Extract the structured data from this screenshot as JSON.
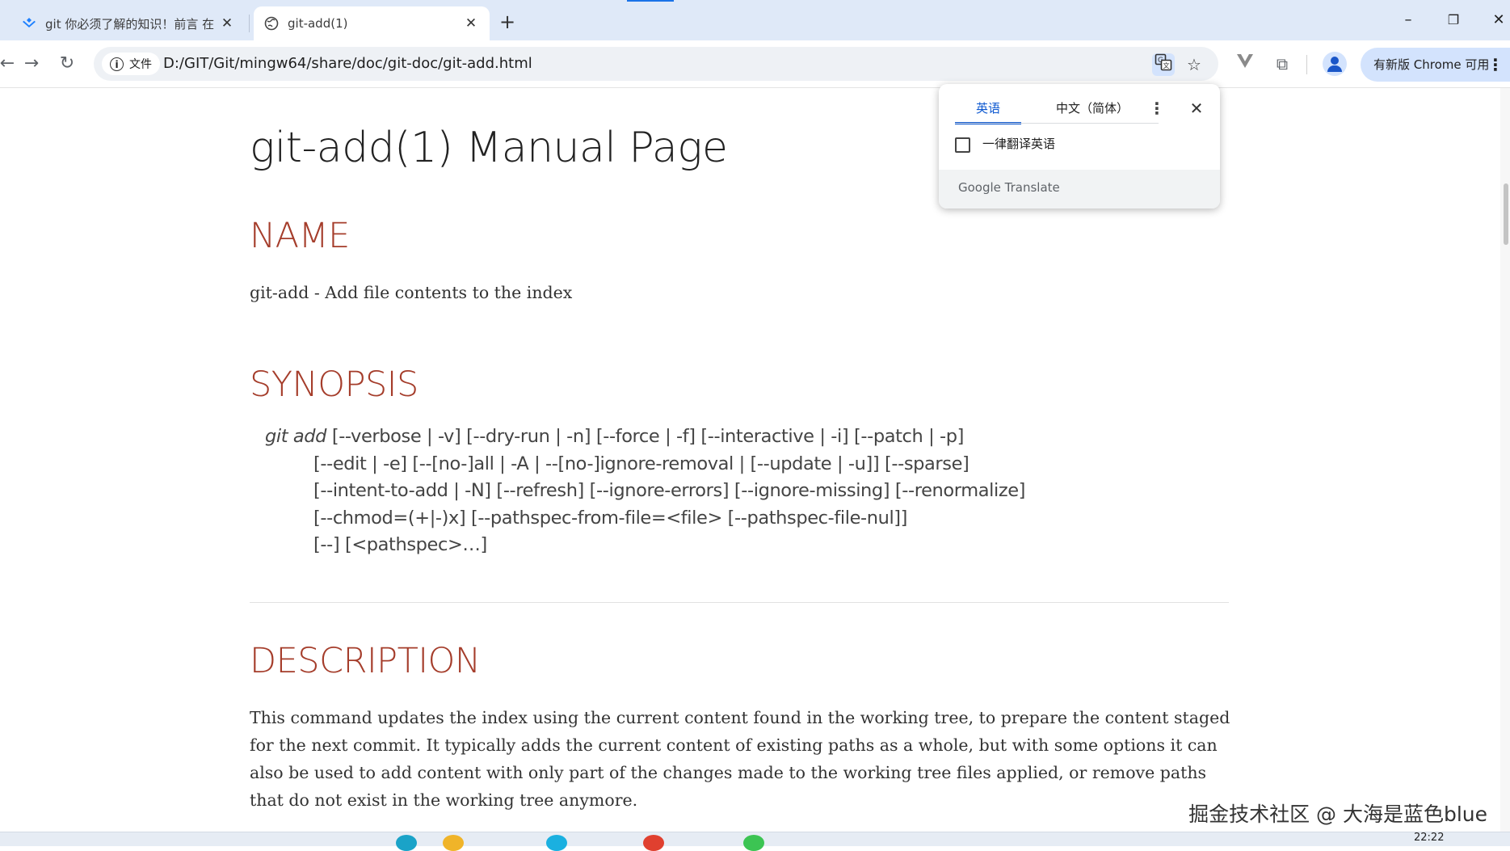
{
  "browser": {
    "tabs": [
      {
        "title": "git 你必须了解的知识！前言 在",
        "favicon": "juejin-icon",
        "active": false
      },
      {
        "title": "git-add(1)",
        "favicon": "globe-icon",
        "active": true
      }
    ],
    "new_tab_symbol": "+",
    "close_symbol": "✕",
    "window_controls": {
      "minimize": "–",
      "restore": "❐",
      "close": "✕"
    },
    "address": {
      "site_chip": "文件",
      "url": "D:/GIT/Git/mingw64/share/doc/git-doc/git-add.html"
    },
    "update_button": "有新版 Chrome 可用",
    "colors": {
      "tabstrip": "#dfe9f8",
      "accent": "#1a73e8"
    }
  },
  "translate_popup": {
    "source_tab": "英语",
    "target_tab": "中文（简体）",
    "always_translate_label": "一律翻译英语",
    "always_translate_checked": false,
    "footer": "Google Translate"
  },
  "page": {
    "title": "git-add(1) Manual Page",
    "sections": {
      "name": {
        "heading": "NAME",
        "text": "git-add - Add file contents to the index"
      },
      "synopsis": {
        "heading": "SYNOPSIS",
        "command": "git add",
        "lines": [
          "[--verbose | -v] [--dry-run | -n] [--force | -f] [--interactive | -i] [--patch | -p]",
          "[--edit | -e] [--[no-]all | -A | --[no-]ignore-removal | [--update | -u]] [--sparse]",
          "[--intent-to-add | -N] [--refresh] [--ignore-errors] [--ignore-missing] [--renormalize]",
          "[--chmod=(+|-)x] [--pathspec-from-file=<file> [--pathspec-file-nul]]",
          "[--] [<pathspec>…​]"
        ]
      },
      "description": {
        "heading": "DESCRIPTION",
        "text": "This command updates the index using the current content found in the working tree, to prepare the content staged for the next commit. It typically adds the current content of existing paths as a whole, but with some options it can also be used to add content with only part of the changes made to the working tree files applied, or remove paths that do not exist in the working tree anymore."
      }
    },
    "colors": {
      "heading": "#a53d2b",
      "body": "#333333"
    }
  },
  "watermark": "掘金技术社区 @ 大海是蓝色blue",
  "taskbar": {
    "clock": "22:22"
  }
}
